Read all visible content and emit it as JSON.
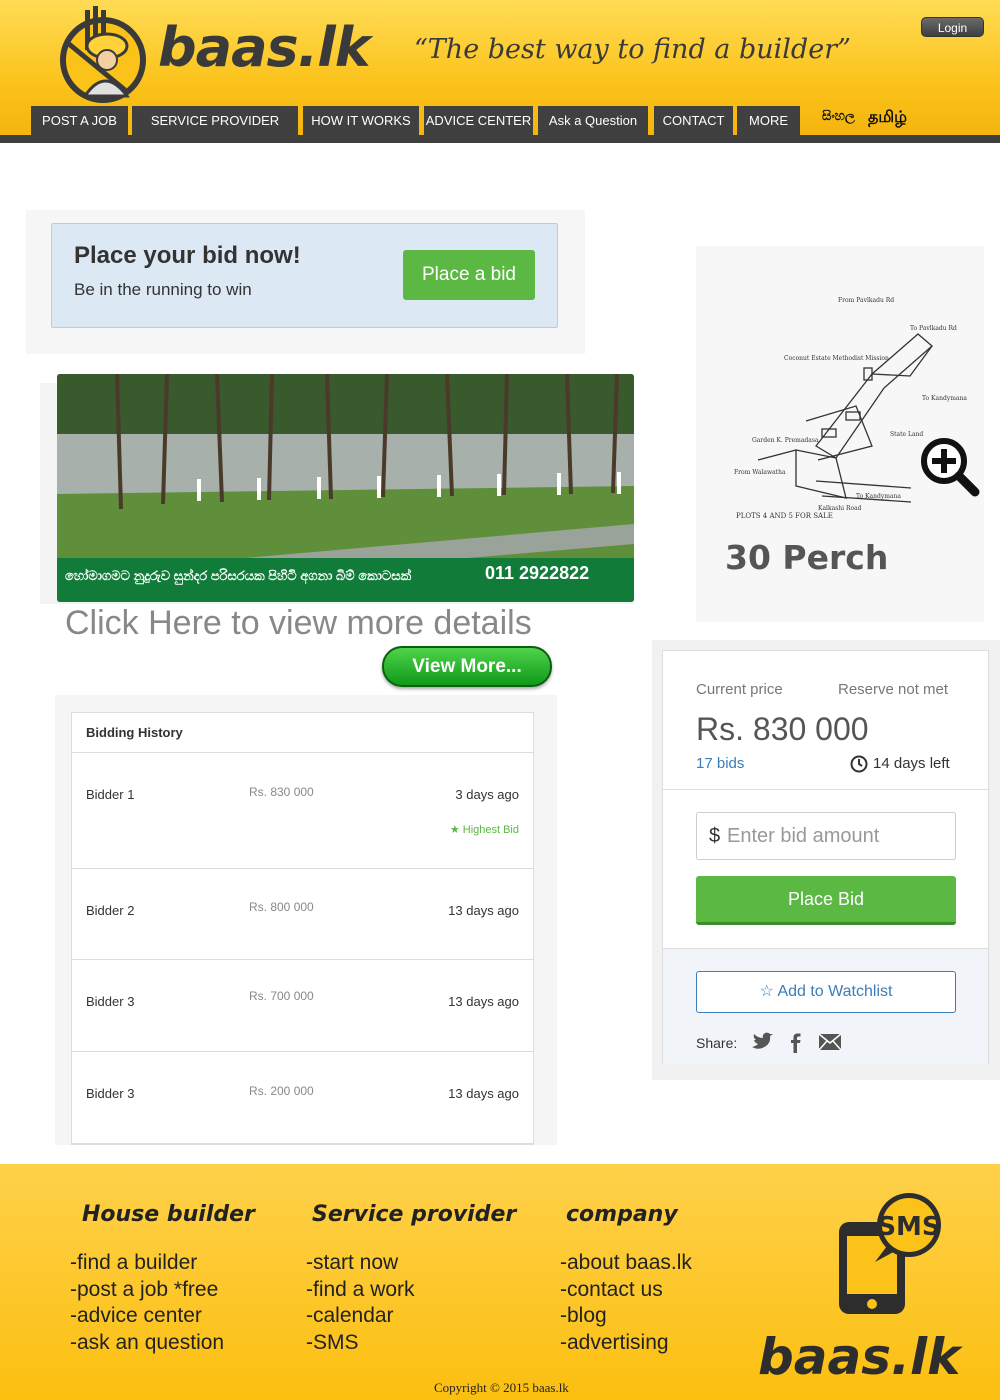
{
  "header": {
    "logo_text": "baas.lk",
    "tagline": "“The best way to find a builder”",
    "login_label": "Login"
  },
  "nav": {
    "items": [
      {
        "label": "POST A JOB"
      },
      {
        "label": "SERVICE PROVIDER START"
      },
      {
        "label": "HOW IT WORKS"
      },
      {
        "label": "ADVICE CENTER"
      },
      {
        "label": "Ask a Question"
      },
      {
        "label": "CONTACT"
      },
      {
        "label": "MORE"
      }
    ],
    "lang_sinhala": "සිංහල",
    "lang_tamil": "தமிழ்"
  },
  "bid_prompt": {
    "title": "Place your bid now!",
    "subtitle": "Be in the running to win",
    "button": "Place a bid"
  },
  "banner": {
    "caption": "හෝමාගමට නුදුරුව සුන්දර පරිසරයක පිහිටි අගනා බිම් කොටසක්",
    "phone": "011 2922822",
    "more_details": "Click Here to view more details",
    "view_more": "View More..."
  },
  "history": {
    "title": "Bidding History",
    "rows": [
      {
        "name": "Bidder 1",
        "amount": "Rs. 830 000",
        "when": "3 days ago",
        "badge": "★ Highest Bid"
      },
      {
        "name": "Bidder 2",
        "amount": "Rs. 800 000",
        "when": "13 days ago",
        "badge": ""
      },
      {
        "name": "Bidder 3",
        "amount": "Rs. 700 000",
        "when": "13 days ago",
        "badge": ""
      },
      {
        "name": "Bidder 3",
        "amount": "Rs. 200 000",
        "when": "13 days ago",
        "badge": ""
      }
    ]
  },
  "map": {
    "area": "30 Perch",
    "plot_label": "PLOTS 4 AND 5 FOR SALE",
    "labels": [
      "From Pavlkadu Rd",
      "To Pavlkadu Rd",
      "Coconut Estate Methodist Mission",
      "To Kandymana",
      "State Land",
      "Garden K. Premadasa",
      "From Walawatha",
      "Kalkashi Road",
      "To Kandymana"
    ]
  },
  "price_card": {
    "current_label": "Current price",
    "reserve_label": "Reserve not met",
    "price": "Rs. 830 000",
    "bids": "17 bids",
    "days_left": "14 days left",
    "currency_symbol": "$",
    "input_placeholder": "Enter bid amount",
    "place_bid": "Place Bid",
    "watchlist": "☆ Add to Watchlist",
    "share_label": "Share:"
  },
  "footer": {
    "columns": [
      {
        "heading": "House builder",
        "links": [
          "-find a builder",
          "-post a job *free",
          "-advice center",
          "-ask an question"
        ]
      },
      {
        "heading": "Service provider",
        "links": [
          "-start now",
          "-find a work",
          "-calendar",
          "-SMS"
        ]
      },
      {
        "heading": "company",
        "links": [
          "-about baas.lk",
          "-contact us",
          "-blog",
          "-advertising"
        ]
      }
    ],
    "sms_label": "SMS",
    "logo": "baas.lk",
    "copyright": "Copyright © 2015 baas.lk"
  },
  "colors": {
    "header_yellow": "#fbc21a",
    "nav_dark": "#404040",
    "green": "#5ab843",
    "link_blue": "#3a7db8",
    "bid_box_blue": "#dde8f5"
  }
}
